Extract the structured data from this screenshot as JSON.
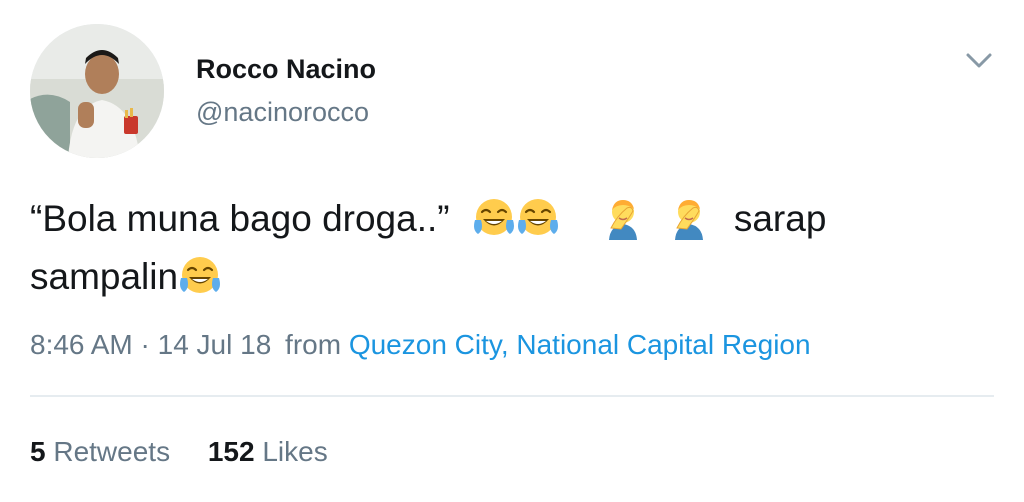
{
  "user": {
    "name": "Rocco Nacino",
    "handle": "@nacinorocco"
  },
  "tweet": {
    "text_part1": "“Bola muna bago droga..”",
    "text_part2": "sarap",
    "text_part3": "sampalin",
    "emojis": [
      "face-with-tears-of-joy-icon",
      "face-with-tears-of-joy-icon",
      "man-facepalming-icon",
      "man-facepalming-icon",
      "face-with-tears-of-joy-icon"
    ]
  },
  "meta": {
    "time": "8:46 AM",
    "separator": "·",
    "date": "14 Jul 18",
    "from_label": "from",
    "location": "Quezon City, National Capital Region"
  },
  "stats": {
    "retweets_count": "5",
    "retweets_label": "Retweets",
    "likes_count": "152",
    "likes_label": "Likes"
  },
  "colors": {
    "text_primary": "#14171a",
    "text_secondary": "#657786",
    "link": "#1b95e0",
    "divider": "#e6ecf0"
  }
}
